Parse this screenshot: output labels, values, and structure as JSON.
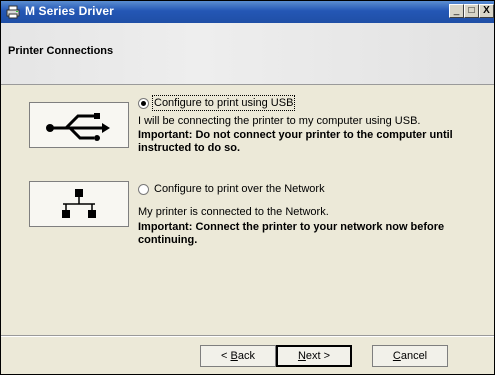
{
  "window": {
    "title": "M Series Driver",
    "buttons": {
      "minimize": "_",
      "maximize": "□",
      "close": "X"
    }
  },
  "header": {
    "title": "Printer Connections"
  },
  "options": [
    {
      "label": "Configure to print using USB",
      "checked": true,
      "description": "I will be connecting the printer to my computer using USB.",
      "important": "Important: Do not connect your printer to the computer until instructed to do so.",
      "icon": "usb-icon"
    },
    {
      "label": "Configure to print over the Network",
      "checked": false,
      "description": "My printer is connected to the Network.",
      "important": "Important: Connect the printer to your network now before continuing.",
      "icon": "network-icon"
    }
  ],
  "footer": {
    "back_label_pre": "< ",
    "back_label_key": "B",
    "back_label_post": "ack",
    "next_label_key": "N",
    "next_label_post": "ext >",
    "cancel_label_key": "C",
    "cancel_label_post": "ancel"
  },
  "colors": {
    "titlebar": "#2457b5",
    "dialog_bg": "#ece9d8"
  }
}
